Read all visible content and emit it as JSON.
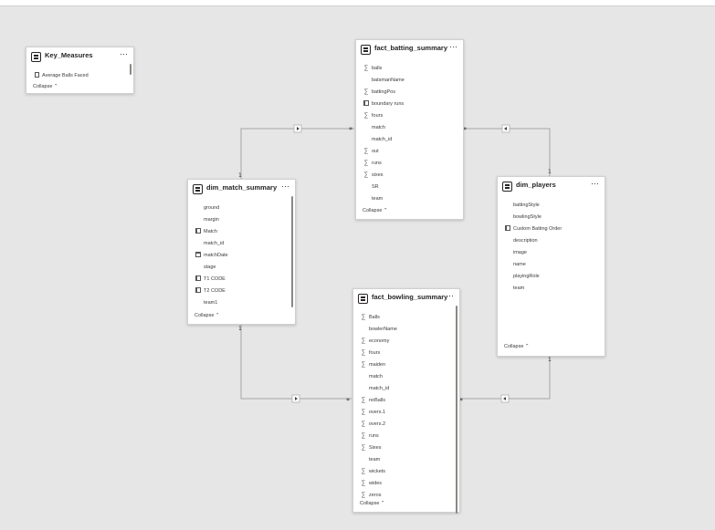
{
  "cards": {
    "key_measures": {
      "title": "Key_Measures",
      "fields": [
        {
          "name": "Average Balls Faced",
          "icon": "calculator-icon"
        }
      ],
      "collapse": "Collapse"
    },
    "fact_batting": {
      "title": "fact_batting_summary",
      "fields": [
        {
          "name": "balls",
          "icon": "sigma-icon"
        },
        {
          "name": "batsmanName",
          "icon": ""
        },
        {
          "name": "battingPos",
          "icon": "sigma-icon"
        },
        {
          "name": "boundary runs",
          "icon": "calculated-column-icon"
        },
        {
          "name": "fours",
          "icon": "sigma-icon"
        },
        {
          "name": "match",
          "icon": ""
        },
        {
          "name": "match_id",
          "icon": ""
        },
        {
          "name": "out",
          "icon": "sigma-icon"
        },
        {
          "name": "runs",
          "icon": "sigma-icon"
        },
        {
          "name": "sixes",
          "icon": "sigma-icon"
        },
        {
          "name": "SR",
          "icon": ""
        },
        {
          "name": "team",
          "icon": ""
        }
      ],
      "collapse": "Collapse"
    },
    "dim_match": {
      "title": "dim_match_summary",
      "fields": [
        {
          "name": "ground",
          "icon": ""
        },
        {
          "name": "margin",
          "icon": ""
        },
        {
          "name": "Match",
          "icon": "calculated-column-icon"
        },
        {
          "name": "match_id",
          "icon": ""
        },
        {
          "name": "matchDate",
          "icon": "calendar-icon"
        },
        {
          "name": "stage",
          "icon": ""
        },
        {
          "name": "T1 CODE",
          "icon": "calculated-column-icon"
        },
        {
          "name": "T2 CODE",
          "icon": "calculated-column-icon"
        },
        {
          "name": "team1",
          "icon": ""
        }
      ],
      "collapse": "Collapse"
    },
    "dim_players": {
      "title": "dim_players",
      "fields": [
        {
          "name": "battingStyle",
          "icon": ""
        },
        {
          "name": "bowlingStyle",
          "icon": ""
        },
        {
          "name": "Custom Batting Order",
          "icon": "hierarchy-icon"
        },
        {
          "name": "description",
          "icon": ""
        },
        {
          "name": "image",
          "icon": ""
        },
        {
          "name": "name",
          "icon": ""
        },
        {
          "name": "playingRole",
          "icon": ""
        },
        {
          "name": "team",
          "icon": ""
        }
      ],
      "collapse": "Collapse"
    },
    "fact_bowling": {
      "title": "fact_bowling_summary",
      "fields": [
        {
          "name": "Balls",
          "icon": "sigma-icon"
        },
        {
          "name": "bowlerName",
          "icon": ""
        },
        {
          "name": "economy",
          "icon": "sigma-icon"
        },
        {
          "name": "fours",
          "icon": "sigma-icon"
        },
        {
          "name": "maiden",
          "icon": "sigma-icon"
        },
        {
          "name": "match",
          "icon": ""
        },
        {
          "name": "match_id",
          "icon": ""
        },
        {
          "name": "noBalls",
          "icon": "sigma-icon"
        },
        {
          "name": "overs.1",
          "icon": "sigma-icon"
        },
        {
          "name": "overs.2",
          "icon": "sigma-icon"
        },
        {
          "name": "runs",
          "icon": "sigma-icon"
        },
        {
          "name": "Sixes",
          "icon": "sigma-icon"
        },
        {
          "name": "team",
          "icon": ""
        },
        {
          "name": "wickets",
          "icon": "sigma-icon"
        },
        {
          "name": "wides",
          "icon": "sigma-icon"
        },
        {
          "name": "zeros",
          "icon": "sigma-icon"
        }
      ],
      "collapse": "Collapse"
    }
  },
  "cardinality": {
    "one": "1",
    "many": "*"
  },
  "colors": {
    "canvas": "#e6e6e6",
    "line": "#a6a6a6",
    "card": "#ffffff"
  }
}
